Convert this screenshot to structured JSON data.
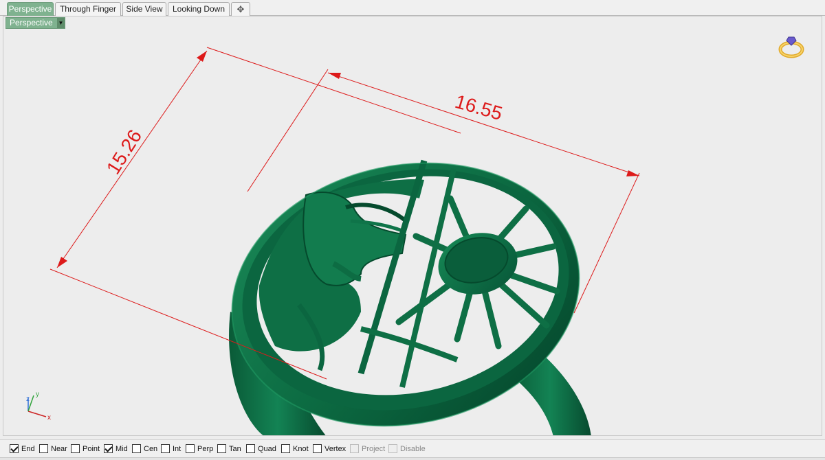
{
  "tabs": [
    {
      "label": "Perspective",
      "active": true
    },
    {
      "label": "Through Finger",
      "active": false
    },
    {
      "label": "Side View",
      "active": false
    },
    {
      "label": "Looking Down",
      "active": false
    }
  ],
  "add_tab_glyph": "✥",
  "viewport": {
    "title": "Perspective",
    "dropdown_glyph": "▼"
  },
  "dimensions": {
    "width_label": "16.55",
    "height_label": "15.26"
  },
  "axes": {
    "x": "x",
    "y": "y",
    "z": "z"
  },
  "colors": {
    "model_green": "#0e6f45",
    "dimension_red": "#dd1a1a",
    "active_tab": "#7fb28f"
  },
  "icons": {
    "top_right": "ring-gem-icon"
  },
  "osnaps": [
    {
      "label": "End",
      "checked": true
    },
    {
      "label": "Near",
      "checked": false
    },
    {
      "label": "Point",
      "checked": false
    },
    {
      "label": "Mid",
      "checked": true
    },
    {
      "label": "Cen",
      "checked": false
    },
    {
      "label": "Int",
      "checked": false
    },
    {
      "label": "Perp",
      "checked": false
    },
    {
      "label": "Tan",
      "checked": false
    },
    {
      "label": "Quad",
      "checked": false
    },
    {
      "label": "Knot",
      "checked": false
    },
    {
      "label": "Vertex",
      "checked": false
    },
    {
      "label": "Project",
      "checked": false,
      "disabled": true
    },
    {
      "label": "Disable",
      "checked": false,
      "disabled": true
    }
  ]
}
